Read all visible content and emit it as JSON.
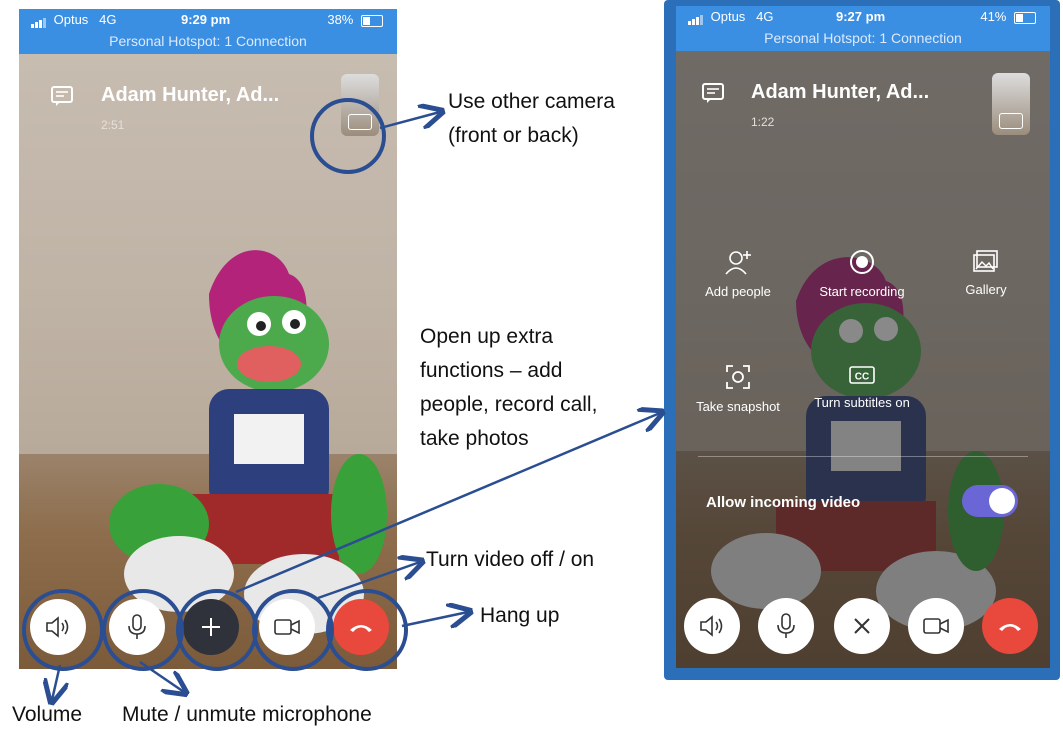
{
  "left_phone": {
    "status": {
      "carrier": "Optus",
      "network": "4G",
      "time": "9:29 pm",
      "battery": "38%",
      "battery_level": 0.38,
      "hotspot": "Personal Hotspot: 1 Connection"
    },
    "call": {
      "name": "Adam Hunter, Ad...",
      "duration": "2:51"
    }
  },
  "right_phone": {
    "status": {
      "carrier": "Optus",
      "network": "4G",
      "time": "9:27 pm",
      "battery": "41%",
      "battery_level": 0.41,
      "hotspot": "Personal Hotspot: 1 Connection"
    },
    "call": {
      "name": "Adam Hunter, Ad...",
      "duration": "1:22"
    },
    "menu": {
      "add_people": "Add people",
      "start_recording": "Start recording",
      "gallery": "Gallery",
      "take_snapshot": "Take snapshot",
      "subtitles": "Turn subtitles on",
      "allow_incoming_video": "Allow incoming video",
      "allow_incoming_video_on": true
    }
  },
  "annotations": {
    "camera_line1": "Use other camera",
    "camera_line2": "(front or back)",
    "extra_line1": "Open up extra",
    "extra_line2": "functions – add",
    "extra_line3": "people, record call,",
    "extra_line4": "take photos",
    "video": "Turn video off / on",
    "hangup": "Hang up",
    "volume": "Volume",
    "mute": "Mute / unmute microphone"
  },
  "colors": {
    "statusbar": "#3a8fe3",
    "hangup": "#e9483d",
    "annotation": "#2a4e91",
    "toggle": "#6b66d6"
  }
}
